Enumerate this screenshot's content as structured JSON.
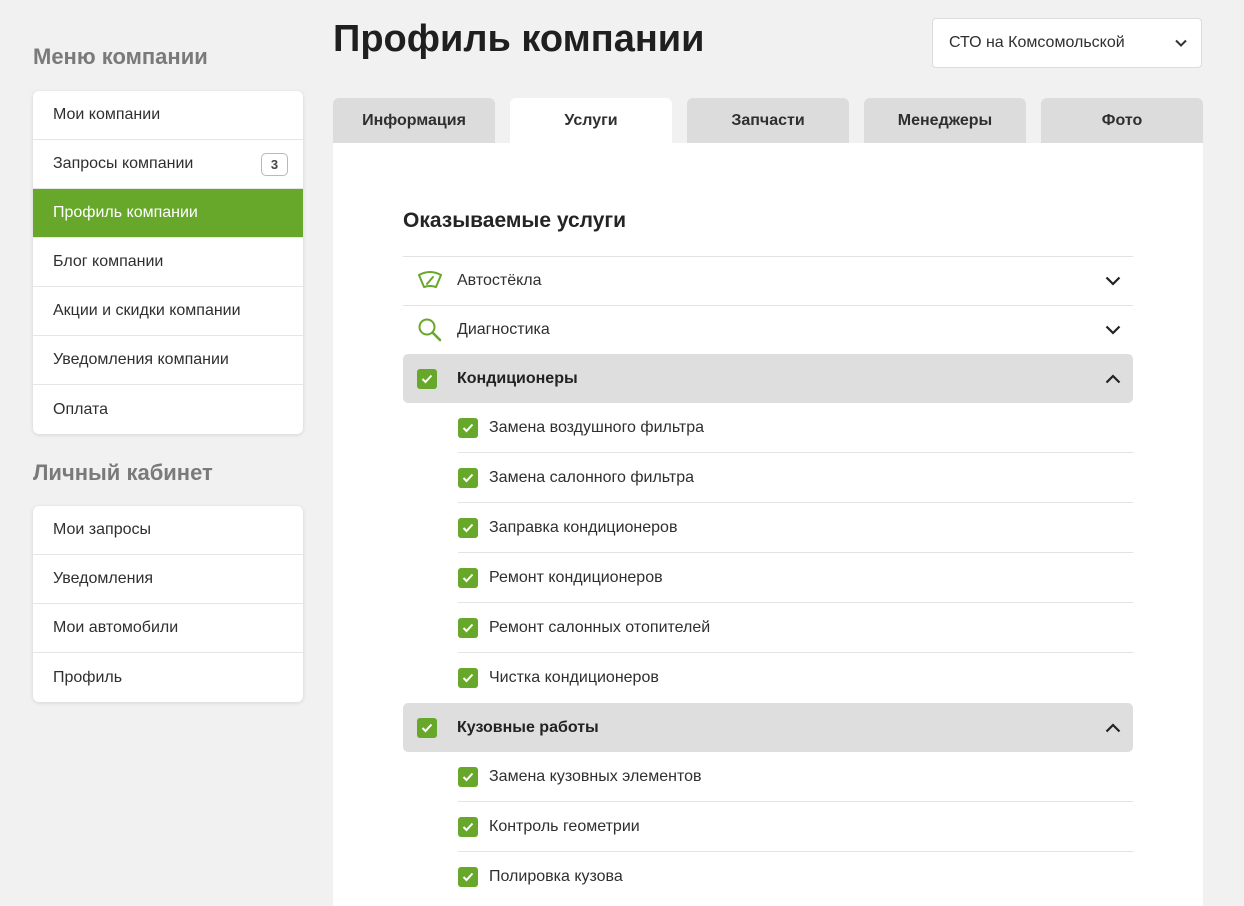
{
  "sidebar": {
    "company_menu_title": "Меню компании",
    "company_menu": [
      {
        "label": "Мои компании"
      },
      {
        "label": "Запросы компании",
        "badge": "3"
      },
      {
        "label": "Профиль компании"
      },
      {
        "label": "Блог компании"
      },
      {
        "label": "Акции и скидки компании"
      },
      {
        "label": "Уведомления компании"
      },
      {
        "label": "Оплата"
      }
    ],
    "cabinet_title": "Личный кабинет",
    "cabinet_menu": [
      {
        "label": "Мои запросы"
      },
      {
        "label": "Уведомления"
      },
      {
        "label": "Мои автомобили"
      },
      {
        "label": "Профиль"
      }
    ]
  },
  "header": {
    "title": "Профиль компании",
    "company_select": "СТО на Комсомольской"
  },
  "tabs": [
    {
      "label": "Информация"
    },
    {
      "label": "Услуги"
    },
    {
      "label": "Запчасти"
    },
    {
      "label": "Менеджеры"
    },
    {
      "label": "Фото"
    }
  ],
  "services": {
    "title": "Оказываемые услуги",
    "categories": [
      {
        "label": "Автостёкла",
        "icon": "windshield-icon"
      },
      {
        "label": "Диагностика",
        "icon": "magnifier-icon"
      },
      {
        "label": "Кондиционеры",
        "checked": true,
        "items": [
          {
            "label": "Замена воздушного фильтра"
          },
          {
            "label": "Замена салонного фильтра"
          },
          {
            "label": "Заправка кондиционеров"
          },
          {
            "label": "Ремонт кондиционеров"
          },
          {
            "label": "Ремонт салонных отопителей"
          },
          {
            "label": "Чистка кондиционеров"
          }
        ]
      },
      {
        "label": "Кузовные работы",
        "checked": true,
        "items": [
          {
            "label": "Замена кузовных элементов"
          },
          {
            "label": "Контроль геометрии"
          },
          {
            "label": "Полировка кузова"
          }
        ]
      }
    ]
  },
  "colors": {
    "accent": "#67a82a",
    "background": "#f1f1f1",
    "tab_inactive": "#dcdcdc"
  }
}
